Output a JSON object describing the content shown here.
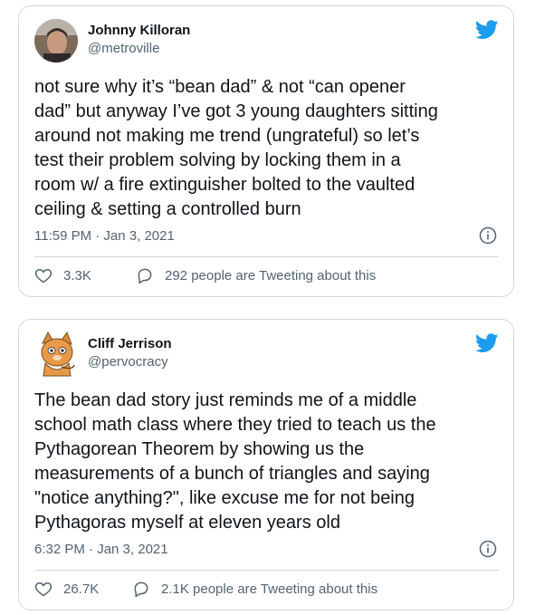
{
  "tweets": [
    {
      "author": "Johnny Killoran",
      "handle": "@metroville",
      "text": "not sure why it’s “bean dad” & not “can opener\ndad” but anyway I’ve got 3 young daughters sitting\naround not making me trend (ungrateful) so let’s\ntest their problem solving by locking them in a\nroom w/ a fire extinguisher bolted to the vaulted\nceiling & setting a controlled burn",
      "timestamp": "11:59 PM · Jan 3, 2021",
      "likes": "3.3K",
      "discussion": "292 people are Tweeting about this"
    },
    {
      "author": "Cliff Jerrison",
      "handle": "@pervocracy",
      "text": "The bean dad story just reminds me of a middle\nschool math class where they tried to teach us the\nPythagorean Theorem by showing us the\nmeasurements of a bunch of triangles and saying\n\"notice anything?\", like excuse me for not being\nPythagoras myself at eleven years old",
      "timestamp": "6:32 PM · Jan 3, 2021",
      "likes": "26.7K",
      "discussion": "2.1K people are Tweeting about this"
    }
  ],
  "colors": {
    "twitter_blue": "#1d9bf0",
    "text": "#0f1419",
    "secondary": "#536471",
    "border": "#cfd9de"
  },
  "icons": [
    "twitter-bird-icon",
    "info-icon",
    "heart-icon",
    "speech-bubble-icon"
  ]
}
